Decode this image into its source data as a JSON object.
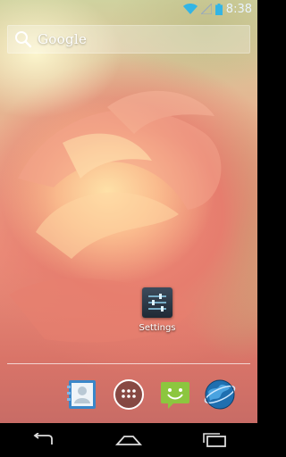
{
  "status_bar": {
    "time": "8:38",
    "icons": [
      "wifi-icon",
      "signal-icon",
      "battery-icon"
    ]
  },
  "search": {
    "label": "Google",
    "icon": "search-icon"
  },
  "home_apps": [
    {
      "label": "Settings",
      "icon": "settings-sliders-icon"
    }
  ],
  "dock": {
    "items": [
      "contacts-icon",
      "all-apps-icon",
      "messaging-icon",
      "browser-globe-icon"
    ]
  },
  "nav_bar": {
    "buttons": [
      "back-icon",
      "home-icon",
      "recent-apps-icon"
    ]
  },
  "colors": {
    "accent": "#33b5e5",
    "status_text": "#e8f4ff"
  }
}
